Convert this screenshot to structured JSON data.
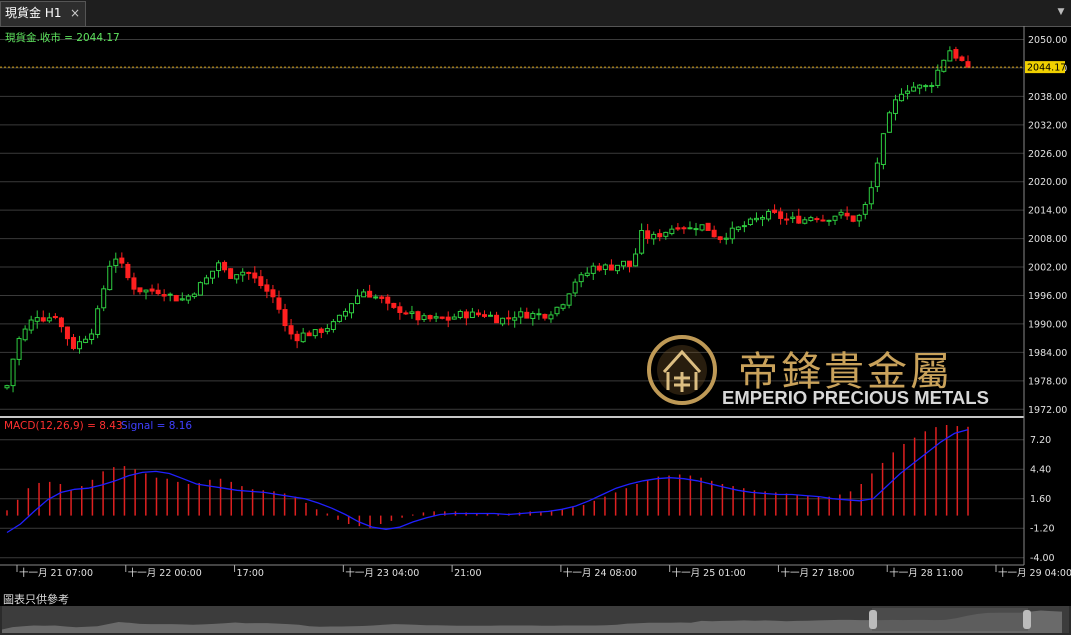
{
  "tab": {
    "title": "現貨金 H1",
    "close_glyph": "×",
    "menu_glyph": "▼"
  },
  "price_panel": {
    "indicator_text": "現貨金.收市 = 2044.17",
    "current_price": "2044.17",
    "colors": {
      "up": "#2ecc40",
      "down": "#ff2020",
      "price_line": "#d4a017",
      "grid": "#3a3a3a"
    }
  },
  "macd_panel": {
    "label": "MACD(12,26,9) = 8.43",
    "signal_label": "Signal = 8.16",
    "colors": {
      "hist": "#e02020",
      "signal": "#2020ff"
    }
  },
  "watermark": {
    "chinese": "帝鋒貴金屬",
    "english": "EMPERIO PRECIOUS METALS"
  },
  "footer_note": "圖表只供參考",
  "chart_data": [
    {
      "type": "candlestick",
      "title": "現貨金 H1",
      "y_ticks": [
        "2050.00",
        "2044.00",
        "2038.00",
        "2032.00",
        "2026.00",
        "2020.00",
        "2014.00",
        "2008.00",
        "2002.00",
        "1996.00",
        "1990.00",
        "1984.00",
        "1978.00",
        "1972.00"
      ],
      "ylim": [
        1971,
        2052
      ],
      "x_ticks": [
        "十一月 21 07:00",
        "十一月 22 00:00",
        "17:00",
        "十一月 23 04:00",
        "21:00",
        "十一月 24 08:00",
        "十一月 25 01:00",
        "十一月 27 18:00",
        "十一月 28 11:00",
        "十一月 29 04:00"
      ],
      "last_close": 2044.17,
      "close_path": [
        1977,
        1986,
        1989,
        1992,
        1991,
        1992,
        1988,
        1985,
        1987,
        1989,
        1997,
        2005,
        2002,
        1998,
        1997,
        1997,
        1997,
        1996,
        1995,
        1996,
        1998,
        2000,
        2003,
        2000,
        2001,
        2001,
        1999,
        1997,
        1995,
        1989,
        1987,
        1988,
        1988,
        1989,
        1990,
        1992,
        1995,
        1997,
        1996,
        1995,
        1993,
        1993,
        1992,
        1991,
        1991,
        1991,
        1991,
        1992,
        1992,
        1992,
        1992,
        1991,
        1991,
        1992,
        1992,
        1992,
        1992,
        1993,
        1995,
        1999,
        2000,
        2002,
        2002,
        2002,
        2003,
        2002,
        2009,
        2008,
        2009,
        2010,
        2011,
        2010,
        2011,
        2010,
        2008,
        2009,
        2010,
        2011,
        2012,
        2013,
        2013,
        2012,
        2012,
        2012,
        2013,
        2012,
        2013,
        2013,
        2012,
        2013,
        2019,
        2028,
        2035,
        2039,
        2040,
        2040,
        2040,
        2044,
        2048,
        2046,
        2044.17
      ]
    },
    {
      "type": "macd",
      "y_ticks": [
        "7.20",
        "4.40",
        "1.60",
        "-1.20",
        "-4.00"
      ],
      "ylim": [
        -4.5,
        8.6
      ],
      "macd": 8.43,
      "signal": 8.16,
      "hist_path": [
        0.5,
        1.5,
        2.6,
        3.1,
        3.2,
        3.0,
        2.4,
        2.8,
        3.4,
        4.2,
        4.6,
        4.7,
        4.4,
        4.0,
        3.6,
        3.5,
        3.2,
        3.0,
        3.1,
        3.4,
        3.5,
        3.2,
        2.8,
        2.5,
        2.4,
        2.3,
        2.1,
        1.8,
        1.2,
        0.6,
        0.2,
        -0.4,
        -0.8,
        -1.0,
        -1.2,
        -0.8,
        -0.5,
        -0.2,
        0.1,
        0.3,
        0.4,
        0.4,
        0.4,
        0.3,
        0.2,
        0.2,
        0.1,
        0.2,
        0.3,
        0.4,
        0.4,
        0.5,
        0.6,
        0.8,
        1.0,
        1.4,
        1.8,
        2.2,
        2.6,
        3.0,
        3.4,
        3.7,
        3.8,
        3.9,
        3.8,
        3.6,
        3.3,
        3.0,
        2.8,
        2.6,
        2.4,
        2.3,
        2.2,
        2.1,
        2.0,
        1.9,
        1.8,
        1.8,
        2.0,
        2.3,
        3.0,
        4.0,
        5.0,
        6.0,
        6.8,
        7.4,
        8.0,
        8.4,
        8.6,
        8.5,
        8.43
      ],
      "signal_path": [
        -1.6,
        -0.8,
        0.4,
        1.5,
        2.2,
        2.5,
        2.6,
        2.9,
        3.3,
        3.8,
        4.1,
        4.2,
        4.0,
        3.5,
        3.0,
        2.8,
        2.6,
        2.4,
        2.3,
        2.2,
        2.0,
        1.8,
        1.6,
        1.2,
        0.7,
        0.1,
        -0.6,
        -1.1,
        -1.3,
        -1.1,
        -0.6,
        -0.2,
        0.1,
        0.2,
        0.2,
        0.2,
        0.2,
        0.1,
        0.2,
        0.3,
        0.4,
        0.6,
        0.9,
        1.4,
        2.0,
        2.6,
        3.0,
        3.3,
        3.5,
        3.6,
        3.5,
        3.3,
        3.0,
        2.7,
        2.4,
        2.2,
        2.1,
        2.0,
        2.0,
        1.9,
        1.8,
        1.6,
        1.5,
        1.4,
        1.6,
        2.8,
        4.0,
        5.0,
        6.0,
        7.0,
        7.8,
        8.16
      ]
    }
  ]
}
